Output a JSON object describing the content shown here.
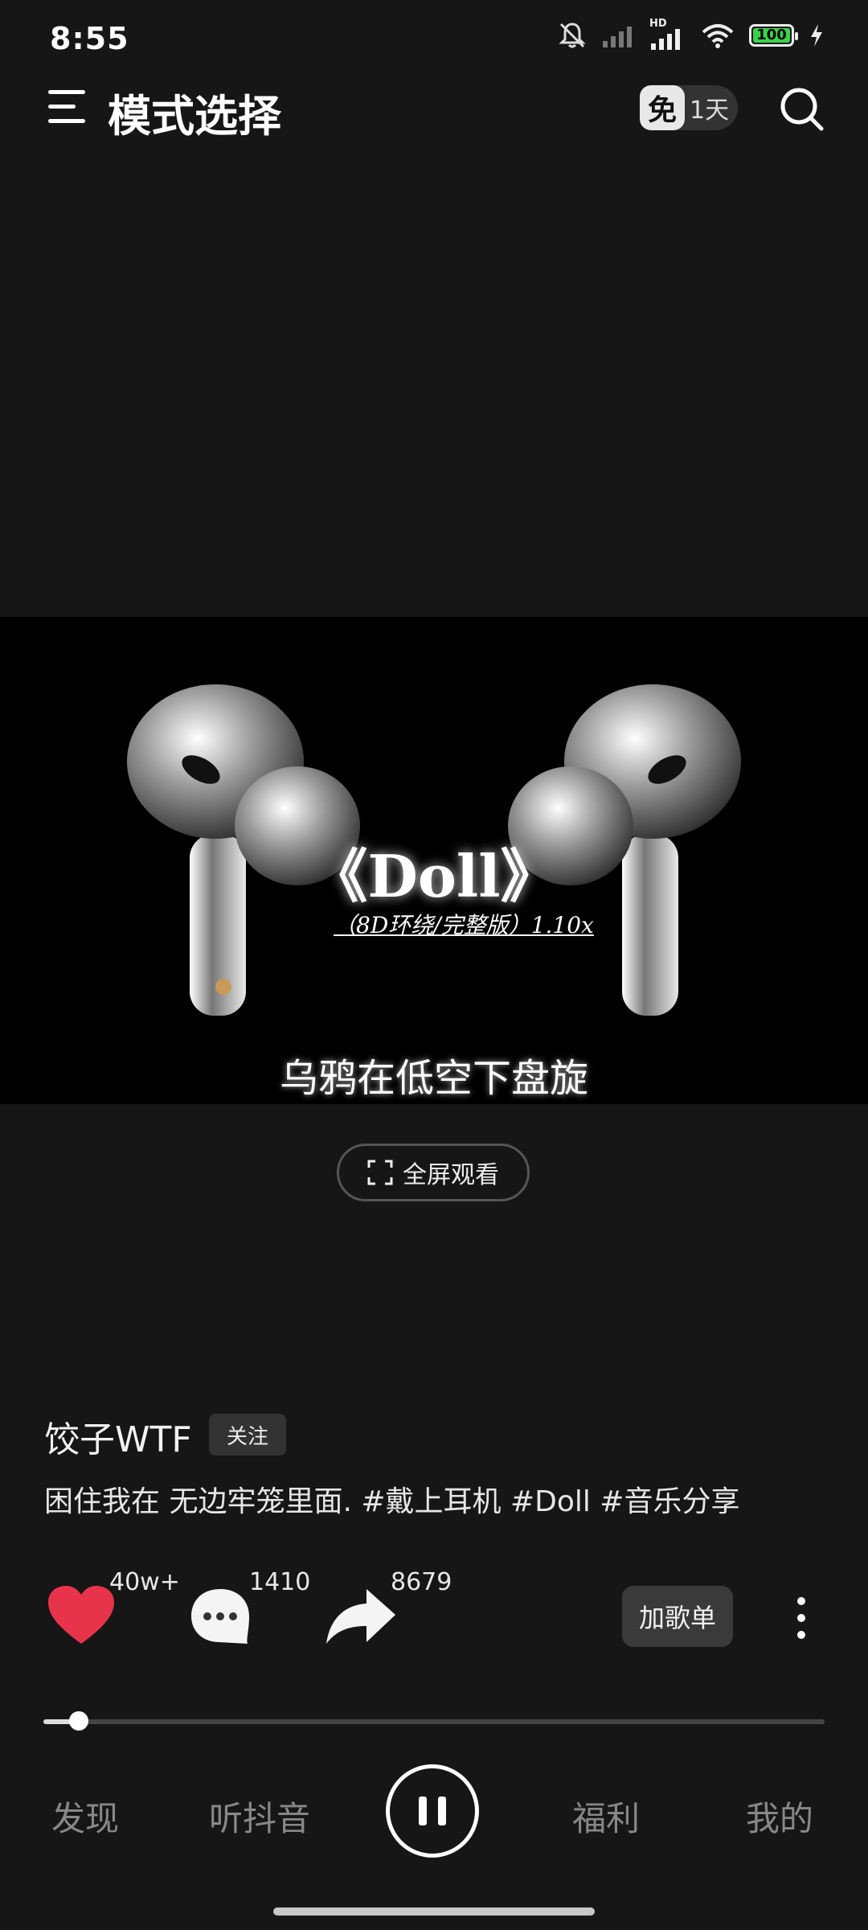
{
  "status_bar": {
    "time": "8:55",
    "battery": "100",
    "hd_label": "HD"
  },
  "header": {
    "title": "模式选择",
    "vip_badge_icon_text": "免",
    "vip_badge_days": "1天"
  },
  "video": {
    "title": "《Doll》",
    "subtitle": "（8D环绕/完整版）1.10x",
    "lyric": "乌鸦在低空下盘旋"
  },
  "fullscreen_button": {
    "label": "全屏观看"
  },
  "post": {
    "author": "饺子WTF",
    "follow_label": "关注",
    "description": "困住我在 无边牢笼里面. #戴上耳机 #Doll #音乐分享"
  },
  "actions": {
    "likes": "40w+",
    "comments": "1410",
    "shares": "8679",
    "add_playlist_label": "加歌单"
  },
  "playback": {
    "progress": 0.045
  },
  "bottom_nav": {
    "discover": "发现",
    "listen_douyin": "听抖音",
    "welfare": "福利",
    "mine": "我的"
  },
  "colors": {
    "like_heart": "#e8344a",
    "background": "#161616"
  }
}
